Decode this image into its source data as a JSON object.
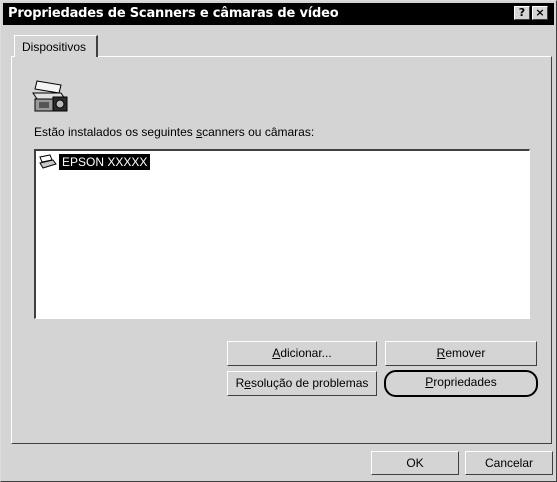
{
  "window": {
    "title": "Propriedades de Scanners e câmaras de vídeo",
    "help_glyph": "?",
    "close_glyph": "×"
  },
  "tabs": [
    {
      "label": "Dispositivos",
      "selected": true
    }
  ],
  "panel": {
    "header_icon": "scanner-camera-icon",
    "list_label_pre": "Estão instalados os seguintes ",
    "list_label_key": "s",
    "list_label_post": "canners ou câmaras:",
    "devices": [
      {
        "name": "EPSON XXXXX",
        "icon": "scanner-icon",
        "selected": true
      }
    ]
  },
  "buttons": {
    "add": {
      "key": "A",
      "rest": "dicionar..."
    },
    "remove": {
      "key": "R",
      "rest": "emover"
    },
    "troubleshoot": {
      "pre": "R",
      "key": "e",
      "rest": "solução de problemas"
    },
    "properties": {
      "key": "P",
      "rest": "ropriedades"
    }
  },
  "footer": {
    "ok": "OK",
    "cancel": "Cancelar"
  }
}
